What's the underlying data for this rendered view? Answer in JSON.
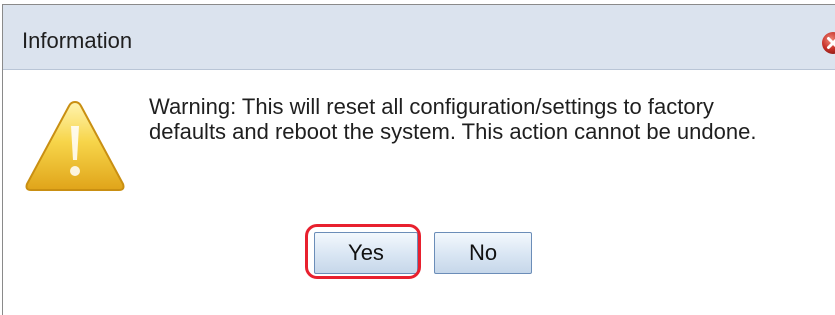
{
  "dialog": {
    "title": "Information",
    "message": "Warning: This will reset all configuration/settings to factory defaults and reboot the system. This action cannot be undone.",
    "buttons": {
      "yes_label": "Yes",
      "no_label": "No"
    },
    "icons": {
      "close": "close-icon",
      "warning": "warning-icon"
    },
    "colors": {
      "titlebar": "#dbe3ee",
      "highlight": "#e8202e",
      "warning": "#f2c230"
    }
  }
}
